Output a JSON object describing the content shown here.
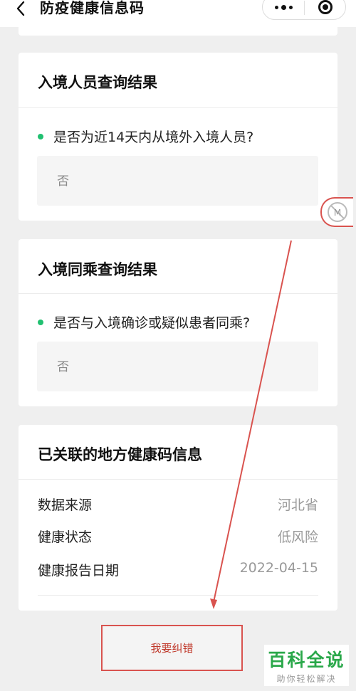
{
  "navbar": {
    "title": "防疫健康信息码",
    "back_icon": "chevron-left-icon",
    "more_icon": "more-dots-icon",
    "close_icon": "target-close-icon"
  },
  "entry_card": {
    "title": "入境人员查询结果",
    "question": "是否为近14天内从境外入境人员?",
    "answer": "否"
  },
  "cotravel_card": {
    "title": "入境同乘查询结果",
    "question": "是否与入境确诊或疑似患者同乘?",
    "answer": "否"
  },
  "local_card": {
    "title": "已关联的地方健康码信息",
    "rows": [
      {
        "label": "数据来源",
        "value": "河北省"
      },
      {
        "label": "健康状态",
        "value": "低风险"
      },
      {
        "label": "健康报告日期",
        "value": "2022-04-15"
      }
    ]
  },
  "float_button": {
    "icon": "no-disturb-icon"
  },
  "correct_button": {
    "label": "我要纠错"
  },
  "watermark": {
    "main": "百科全说",
    "sub": "助你轻松解决"
  },
  "colors": {
    "accent_green": "#20c070",
    "annotation_red": "#d9534f",
    "watermark_green": "#2aa84a"
  }
}
